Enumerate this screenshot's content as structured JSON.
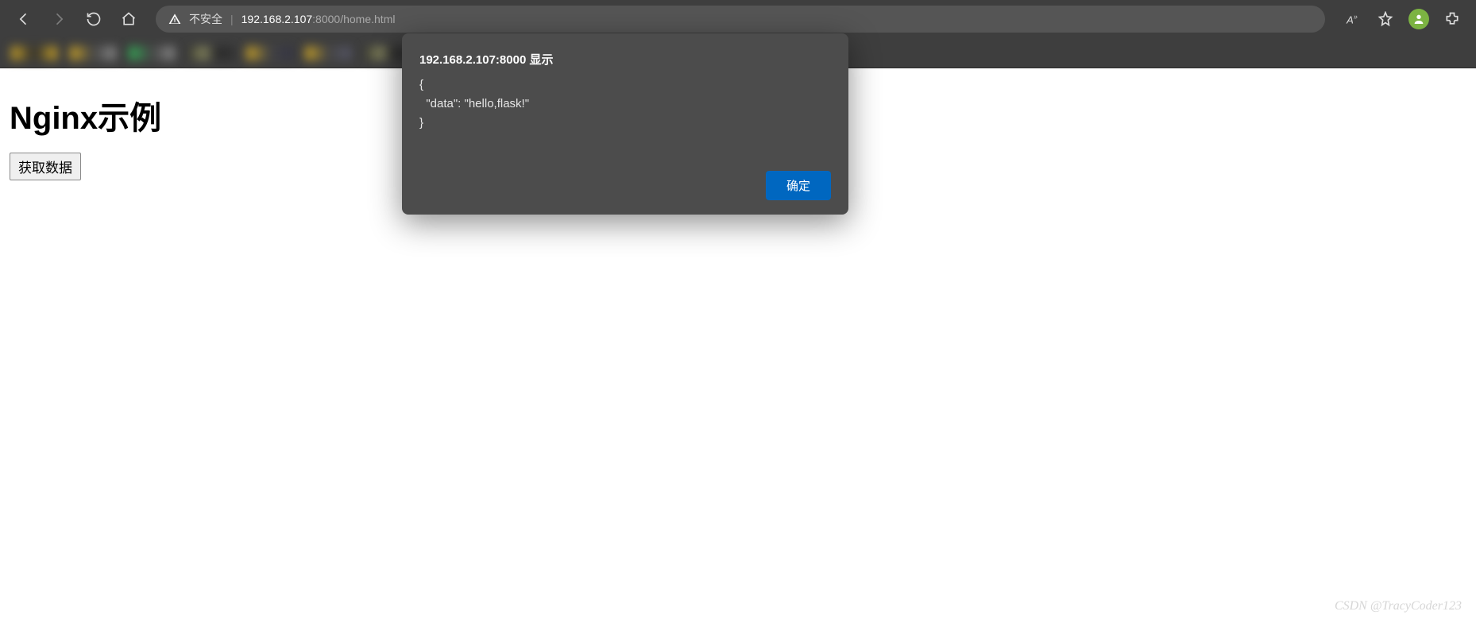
{
  "browser": {
    "security_warning": "不安全",
    "url_host": "192.168.2.107",
    "url_port": ":8000",
    "url_path": "/home.html"
  },
  "page": {
    "heading": "Nginx示例",
    "fetch_button": "获取数据"
  },
  "alert": {
    "title": "192.168.2.107:8000 显示",
    "body": "{\n  \"data\": \"hello,flask!\"\n}",
    "ok_label": "确定"
  },
  "watermark": "CSDN @TracyCoder123"
}
